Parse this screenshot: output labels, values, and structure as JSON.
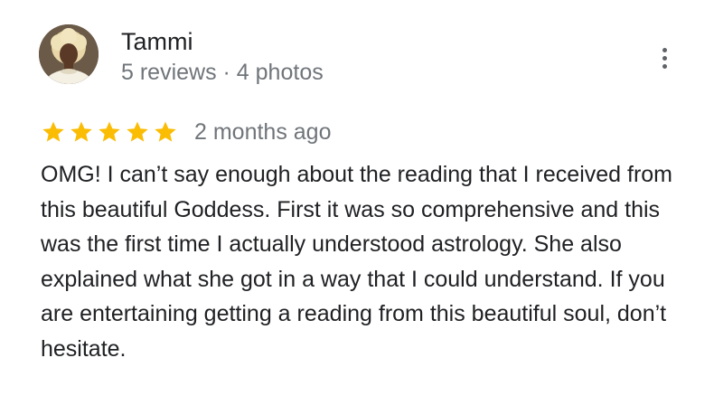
{
  "author": {
    "name": "Tammi",
    "meta": "5 reviews · 4 photos"
  },
  "rating": {
    "stars": 5,
    "max": 5,
    "star_color": "#fbbc04"
  },
  "review": {
    "date": "2 months ago",
    "text": "OMG! I can’t say enough about the reading that I received from this beautiful Goddess. First it was so comprehensive and this was the first time I actually understood astrology. She also explained what she got in a way that I could understand. If you are entertaining getting a reading from this beautiful soul, don’t hesitate."
  },
  "icons": {
    "more": "more-vert-icon",
    "star": "star-icon"
  }
}
